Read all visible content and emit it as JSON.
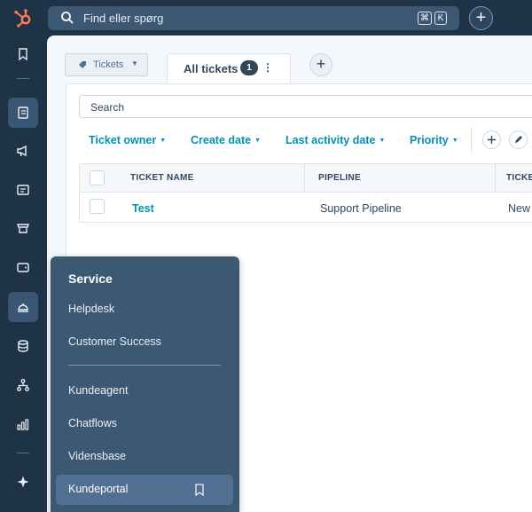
{
  "topbar": {
    "logo_icon": "hubspot-sprocket-icon",
    "search_placeholder": "Find eller spørg",
    "shortcut_keys": [
      "⌘",
      "K"
    ],
    "create_label": "+"
  },
  "rail": {
    "items": [
      {
        "icon": "bookmark-icon"
      },
      {
        "icon": "records-icon",
        "active": true
      },
      {
        "icon": "megaphone-icon"
      },
      {
        "icon": "content-icon"
      },
      {
        "icon": "commerce-icon"
      },
      {
        "icon": "wallet-icon"
      },
      {
        "icon": "service-bell-icon",
        "active": true
      },
      {
        "icon": "database-icon"
      },
      {
        "icon": "workflows-icon"
      },
      {
        "icon": "reports-icon"
      },
      {
        "icon": "sparkle-icon"
      }
    ]
  },
  "view_bar": {
    "object_selector": "Tickets",
    "active_tab": {
      "label": "All tickets",
      "count": "1"
    },
    "add_view_label": "+"
  },
  "filters": {
    "search_placeholder": "Search",
    "items": [
      "Ticket owner",
      "Create date",
      "Last activity date",
      "Priority"
    ]
  },
  "table": {
    "columns": [
      "TICKET NAME",
      "PIPELINE",
      "TICKET"
    ],
    "rows": [
      {
        "name": "Test",
        "pipeline": "Support Pipeline",
        "status": "New"
      }
    ]
  },
  "flyout": {
    "title": "Service",
    "items": [
      "Helpdesk",
      "Customer Success",
      "Kundeagent",
      "Chatflows",
      "Vidensbase",
      "Kundeportal"
    ],
    "active_item": "Kundeportal"
  },
  "colors": {
    "nav_dark": "#1f3347",
    "flyout": "#3d5873",
    "link": "#0091ae",
    "brand_orange": "#ff7a59"
  }
}
